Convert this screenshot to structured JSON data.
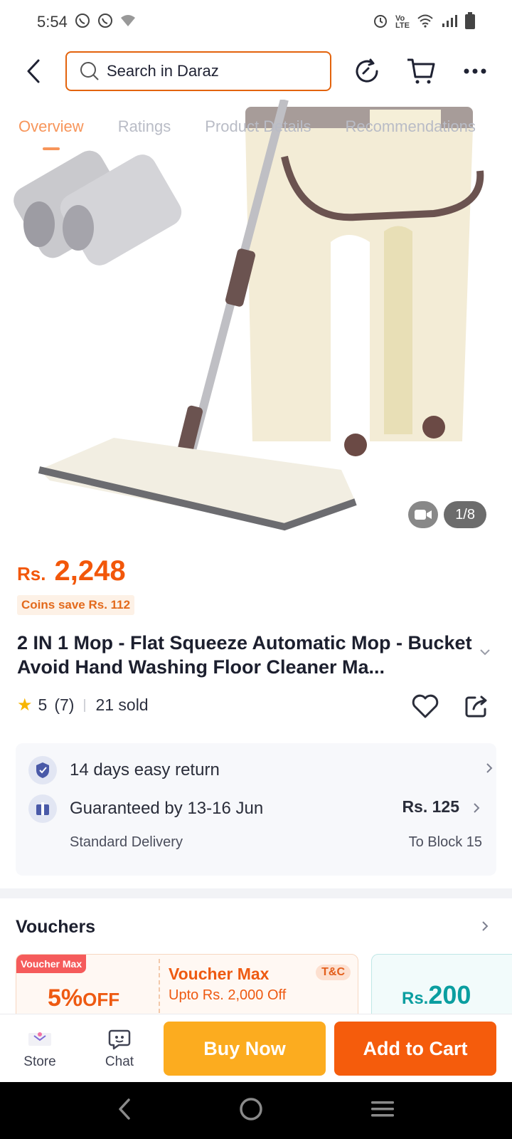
{
  "status_bar": {
    "time": "5:54",
    "icons_left": [
      "whatsapp-icon",
      "whatsapp-icon",
      "wifi-question-icon"
    ],
    "icons_right": [
      "alarm-icon",
      "volte-icon",
      "wifi-icon",
      "signal-icon",
      "battery-icon"
    ]
  },
  "top_nav": {
    "search_placeholder": "Search in Daraz",
    "icons": [
      "back-arrow-icon",
      "search-icon",
      "history-icon",
      "cart-icon",
      "more-dots-icon"
    ]
  },
  "tabs": [
    "Overview",
    "Ratings",
    "Product Details",
    "Recommendations"
  ],
  "active_tab": "Overview",
  "media": {
    "counter": "1/8",
    "has_video": true
  },
  "price": {
    "currency": "Rs.",
    "amount": "2,248",
    "coins_save": "Coins save Rs. 112"
  },
  "product": {
    "title": "2 IN 1 Mop - Flat Squeeze Automatic Mop - Bucket Avoid Hand Washing Floor Cleaner Ma...",
    "rating": "5",
    "reviews": "(7)",
    "sold": "21 sold"
  },
  "service": {
    "return_text": "14 days easy return",
    "delivery_text": "Guaranteed by 13-16 Jun",
    "delivery_type": "Standard Delivery",
    "delivery_price": "Rs. 125",
    "destination": "To Block 15"
  },
  "vouchers": {
    "title": "Vouchers",
    "card1": {
      "tag": "Voucher Max",
      "off": "5%",
      "off_suffix": "OFF",
      "name": "Voucher Max",
      "desc": "Upto Rs. 2,000 Off",
      "tc": "T&C"
    },
    "card2": {
      "currency": "Rs.",
      "amount": "200"
    }
  },
  "bottom_bar": {
    "store": "Store",
    "chat": "Chat",
    "buy_now": "Buy Now",
    "add_to_cart": "Add to Cart"
  },
  "colors": {
    "accent": "#f57224",
    "buy": "#fcac1f",
    "cart": "#f55c0c",
    "teal": "#0b9ea0"
  }
}
